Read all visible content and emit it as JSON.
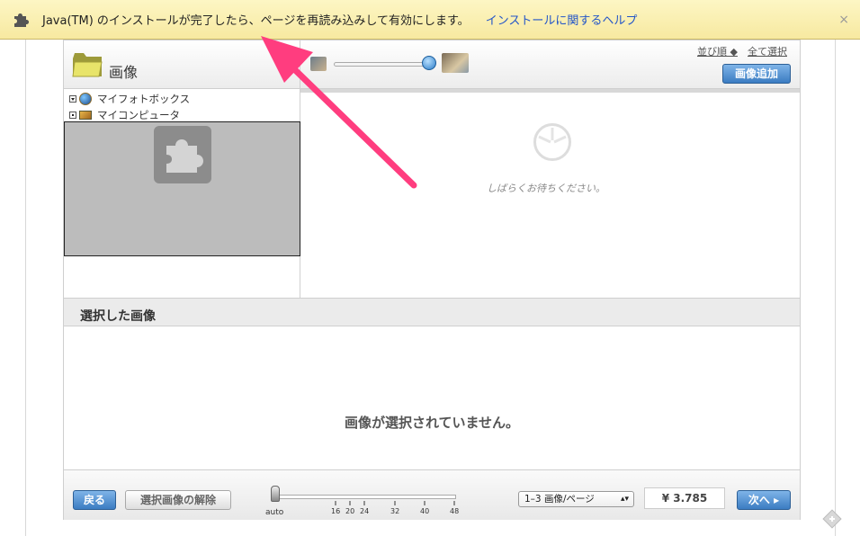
{
  "infobar": {
    "message": "Java(TM) のインストールが完了したら、ページを再読み込みして有効にします。",
    "help_link": "インストールに関するヘルプ",
    "close": "×"
  },
  "header": {
    "title": "画像",
    "sort_label": "並び順 ◆",
    "select_all": "全て選択",
    "add_button": "画像追加"
  },
  "tree": {
    "items": [
      {
        "label": "マイフォトボックス",
        "icon": "globe-icon"
      },
      {
        "label": "マイコンピュータ",
        "icon": "monitor-icon"
      }
    ]
  },
  "viewer": {
    "loading_text": "しばらくお待ちください。"
  },
  "selected": {
    "title": "選択した画像",
    "empty_message": "画像が選択されていません。"
  },
  "footer": {
    "back_button": "戻る",
    "clear_button": "選択画像の解除",
    "zoom_auto": "auto",
    "zoom_ticks": [
      "16",
      "20",
      "24",
      "32",
      "40",
      "48"
    ],
    "per_page": "1–3 画像/ページ",
    "price": "¥ 3.785",
    "next_button": "次へ ▸"
  }
}
